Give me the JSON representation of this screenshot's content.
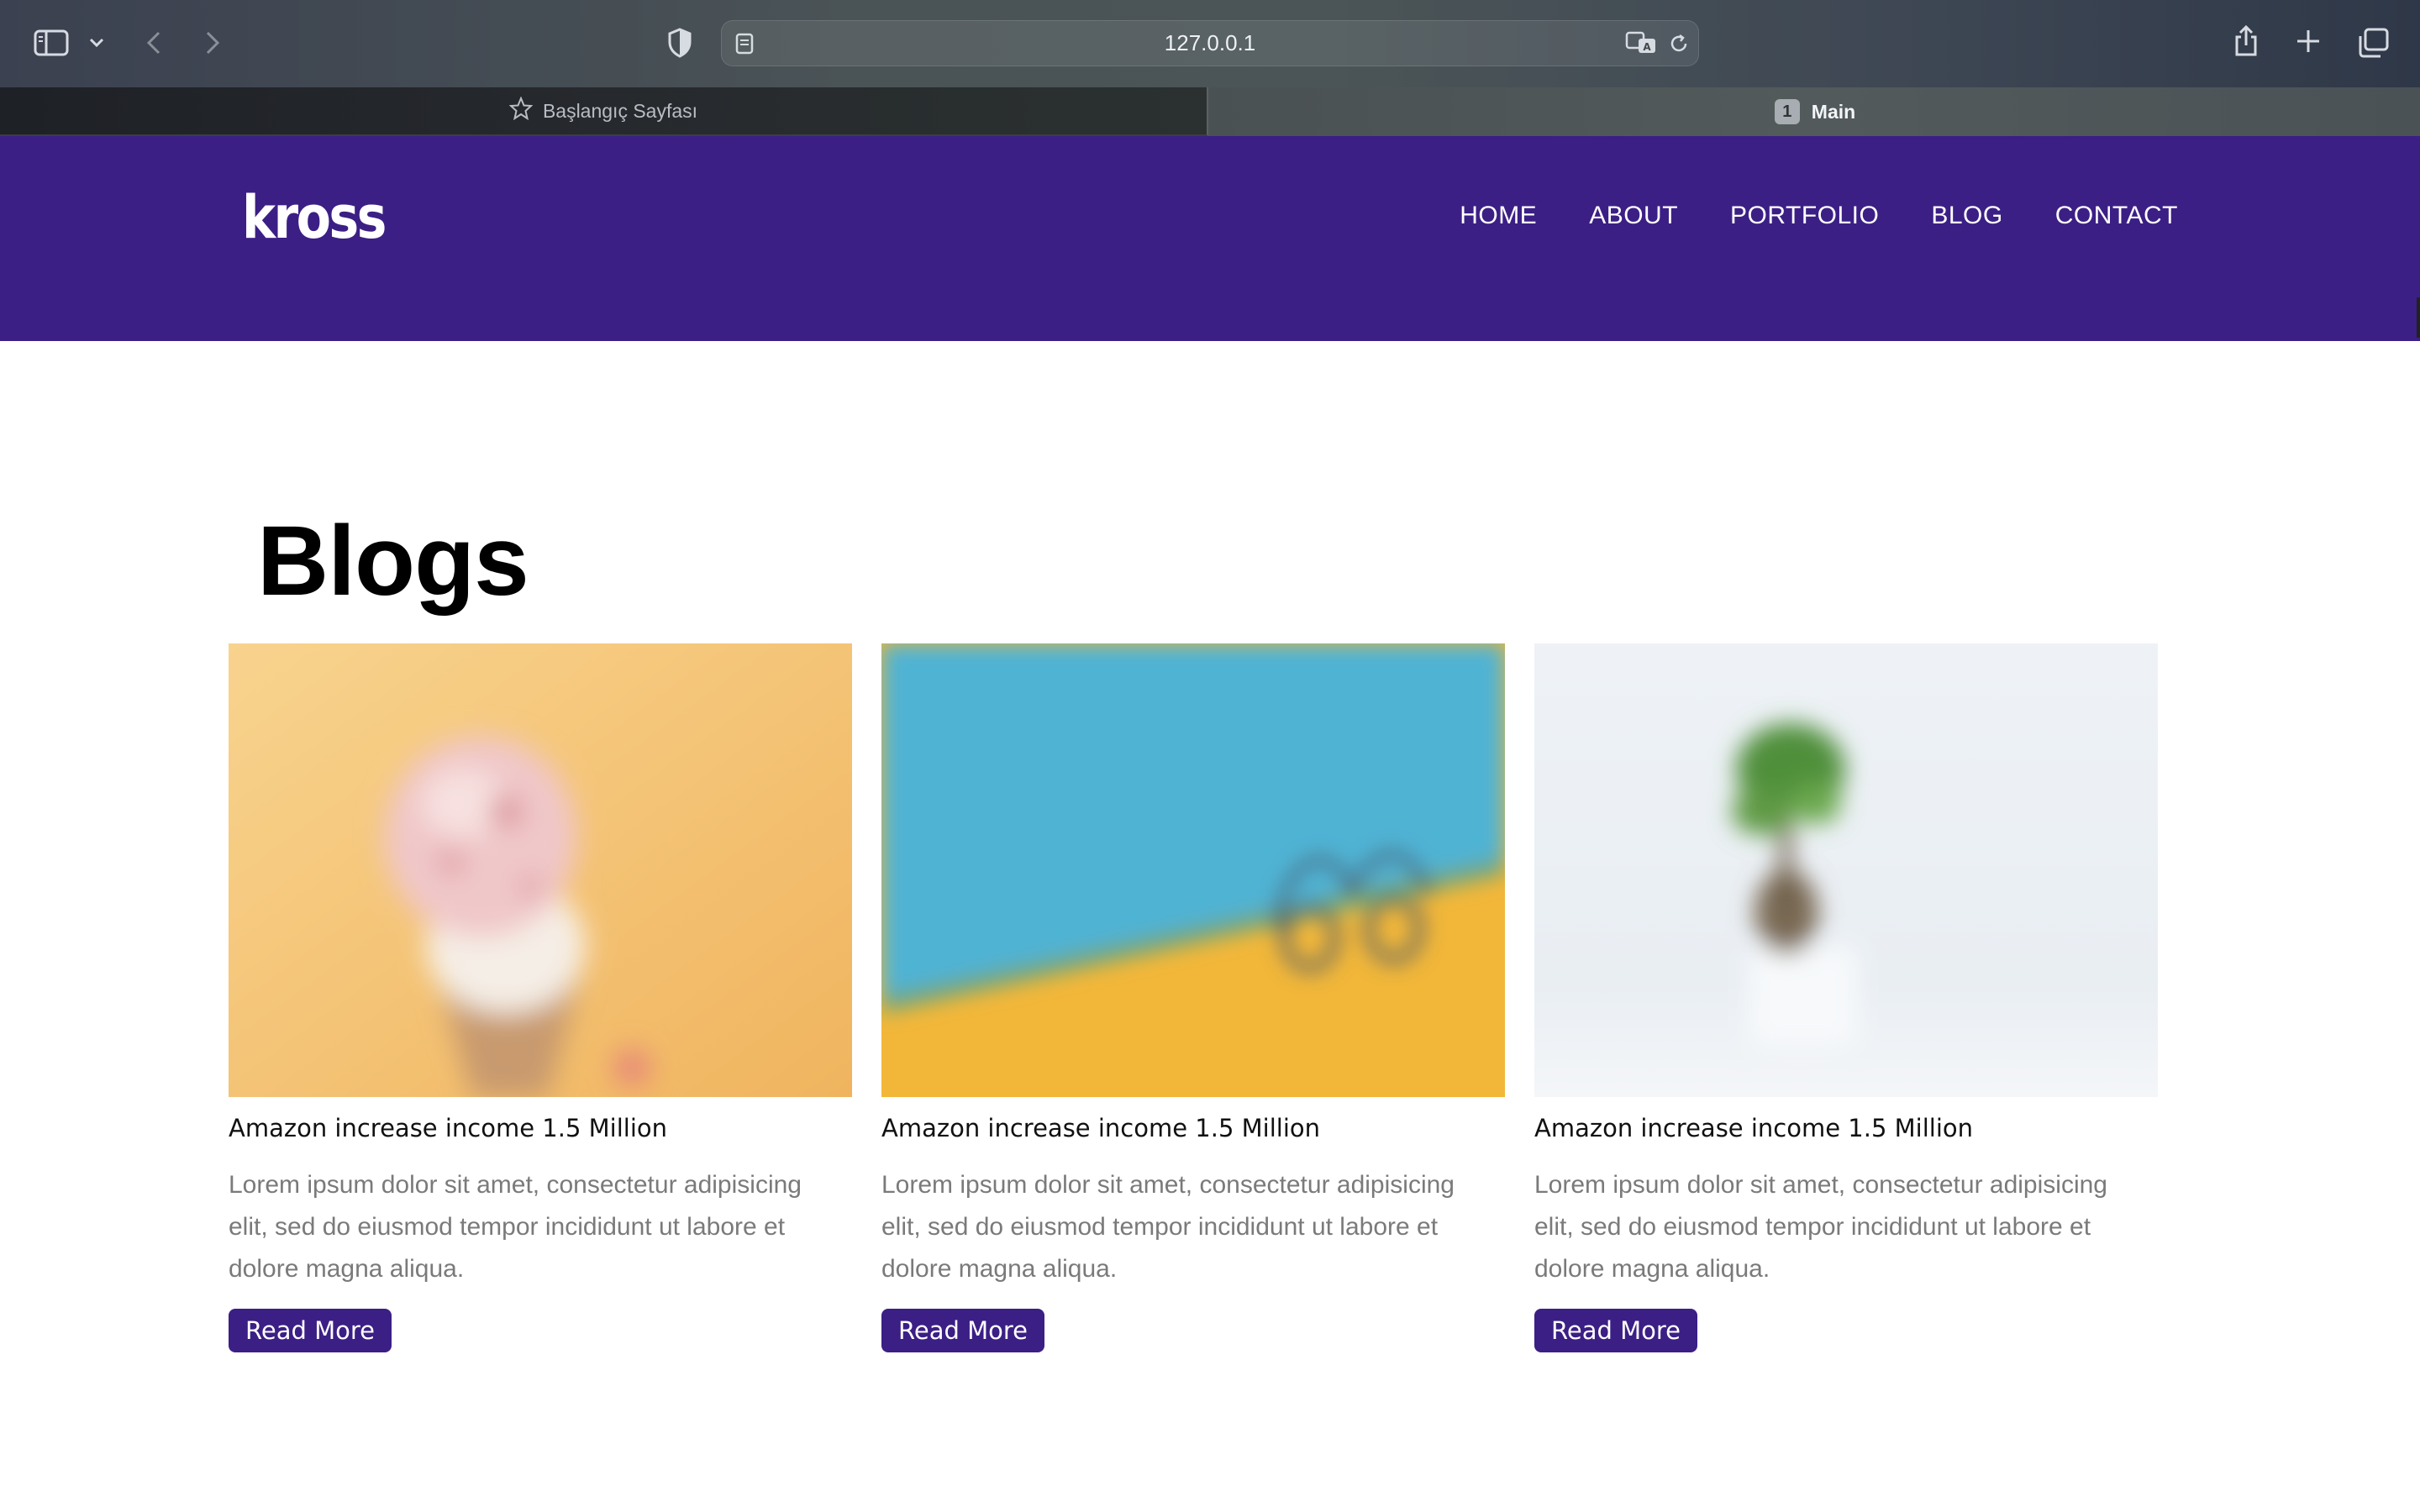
{
  "browser": {
    "address": "127.0.0.1",
    "tabs": [
      {
        "label": "Başlangıç Sayfası",
        "active": false
      },
      {
        "label": "Main",
        "active": true,
        "badge": "1"
      }
    ]
  },
  "header": {
    "logo": "kross",
    "nav": [
      "HOME",
      "ABOUT",
      "PORTFOLIO",
      "BLOG",
      "CONTACT"
    ],
    "background_color": "#3b1f85"
  },
  "main": {
    "title": "Blogs",
    "cards": [
      {
        "image": "ice-cream-cone-photo",
        "title": "Amazon increase income 1.5 Million",
        "text": "Lorem ipsum dolor sit amet, consectetur adipisicing elit, sed do eiusmod tempor incididunt ut labore et dolore magna aliqua.",
        "button": "Read More"
      },
      {
        "image": "sunglasses-on-blue-yellow-wall-photo",
        "title": "Amazon increase income 1.5 Million",
        "text": "Lorem ipsum dolor sit amet, consectetur adipisicing elit, sed do eiusmod tempor incididunt ut labore et dolore magna aliqua.",
        "button": "Read More"
      },
      {
        "image": "bonsai-plant-photo",
        "title": "Amazon increase income 1.5 Million",
        "text": "Lorem ipsum dolor sit amet, consectetur adipisicing elit, sed do eiusmod tempor incididunt ut labore et dolore magna aliqua.",
        "button": "Read More"
      }
    ],
    "accent_color": "#3b1f85"
  }
}
